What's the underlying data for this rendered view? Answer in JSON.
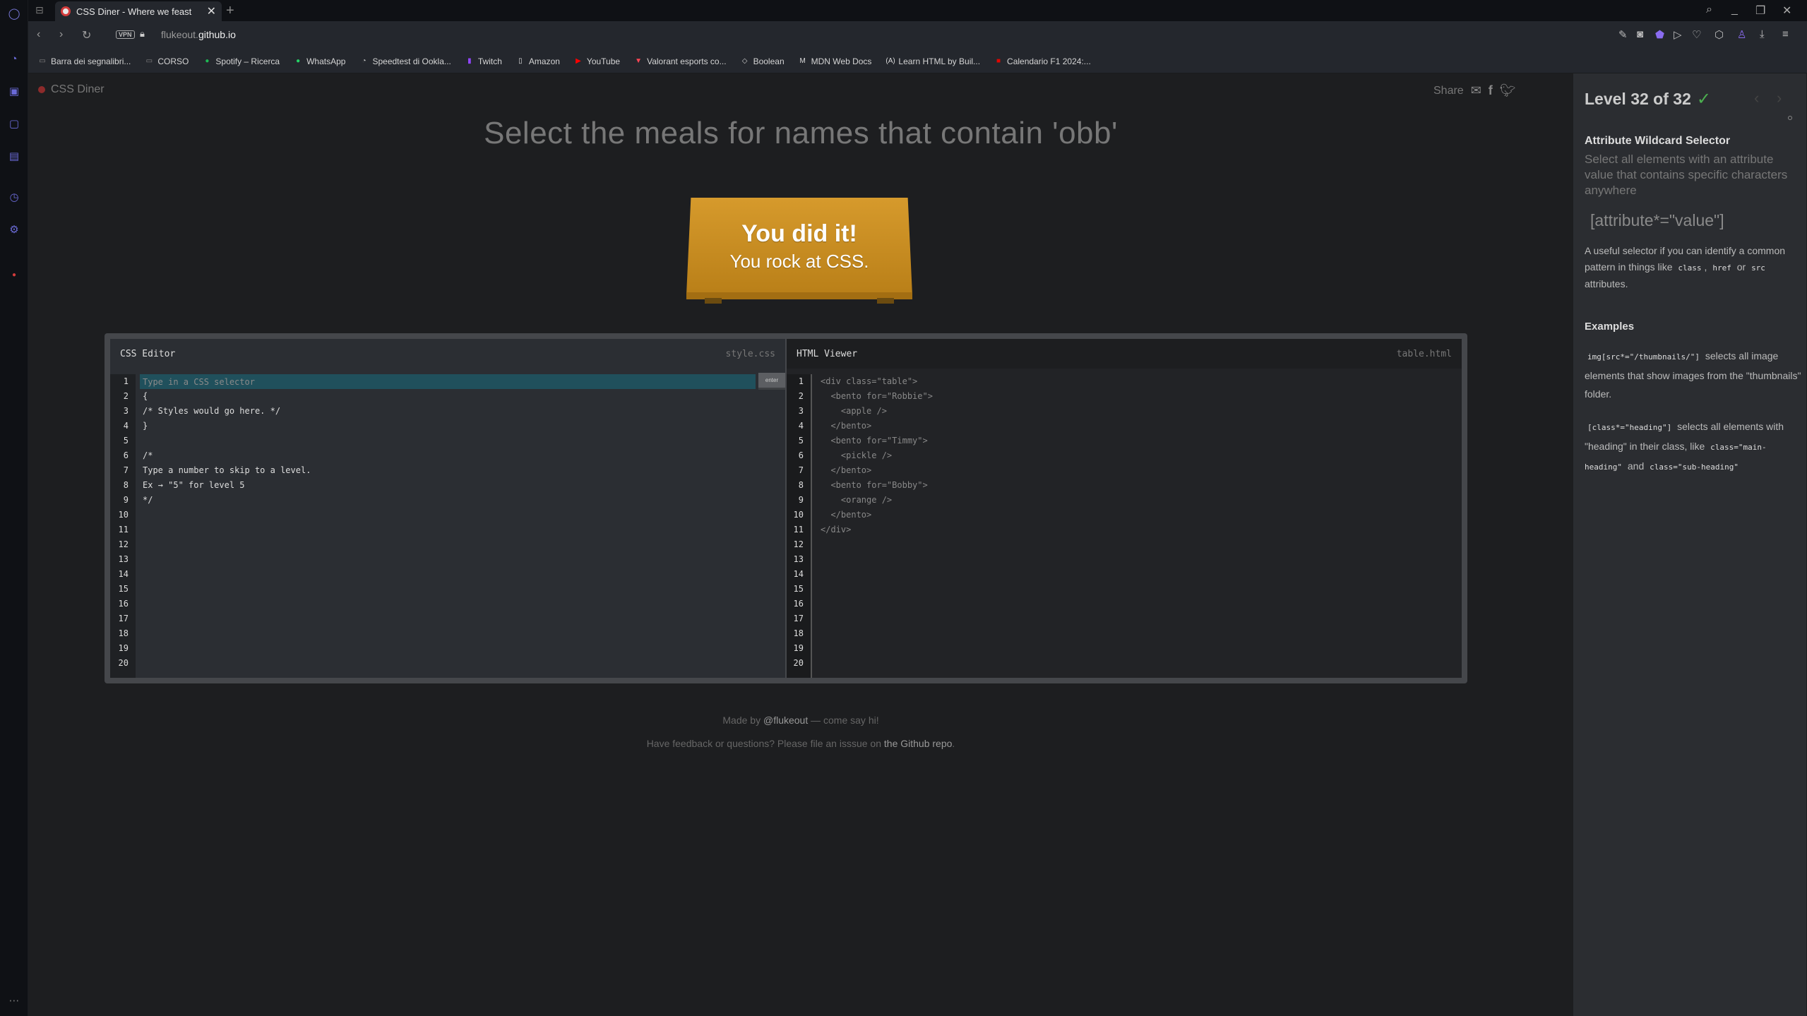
{
  "browser": {
    "tab_title": "CSS Diner - Where we feast",
    "url_host_prefix": "flukeout.",
    "url_host_domain": "github.io",
    "vpn_label": "VPN",
    "bookmarks": [
      {
        "label": "Barra dei segnalibri...",
        "icon": "folder-icon",
        "color": "#888888"
      },
      {
        "label": "CORSO",
        "icon": "folder-icon",
        "color": "#888888"
      },
      {
        "label": "Spotify – Ricerca",
        "icon": "spotify-icon",
        "color": "#1db954"
      },
      {
        "label": "WhatsApp",
        "icon": "whatsapp-icon",
        "color": "#25d366"
      },
      {
        "label": "Speedtest di Ookla...",
        "icon": "speedtest-icon",
        "color": "#cccccc"
      },
      {
        "label": "Twitch",
        "icon": "twitch-icon",
        "color": "#9146ff"
      },
      {
        "label": "Amazon",
        "icon": "page-icon",
        "color": "#dddddd"
      },
      {
        "label": "YouTube",
        "icon": "youtube-icon",
        "color": "#ff0000"
      },
      {
        "label": "Valorant esports co...",
        "icon": "valorant-icon",
        "color": "#ff4655"
      },
      {
        "label": "Boolean",
        "icon": "boolean-icon",
        "color": "#cccccc"
      },
      {
        "label": "MDN Web Docs",
        "icon": "mdn-icon",
        "color": "#dddddd"
      },
      {
        "label": "Learn HTML by Buil...",
        "icon": "freecodecamp-icon",
        "color": "#dddddd"
      },
      {
        "label": "Calendario F1 2024:...",
        "icon": "f1-icon",
        "color": "#e10600"
      }
    ]
  },
  "page": {
    "logo": "CSS Diner",
    "share_label": "Share",
    "instruction": "Select the meals for names that contain 'obb'",
    "win_title": "You did it!",
    "win_subtitle": "You rock at CSS.",
    "css_editor": {
      "title": "CSS Editor",
      "file": "style.css",
      "placeholder": "Type in a CSS selector",
      "enter_label": "enter",
      "lines": [
        "",
        "{",
        "/* Styles would go here. */",
        "}",
        "",
        "/*",
        "Type a number to skip to a level.",
        "Ex → \"5\" for level 5",
        "*/"
      ]
    },
    "html_viewer": {
      "title": "HTML Viewer",
      "file": "table.html",
      "lines": [
        "<div class=\"table\">",
        "  <bento for=\"Robbie\">",
        "    <apple />",
        "  </bento>",
        "  <bento for=\"Timmy\">",
        "    <pickle />",
        "  </bento>",
        "  <bento for=\"Bobby\">",
        "    <orange />",
        "  </bento>",
        "</div>"
      ]
    },
    "line_numbers": [
      "1",
      "2",
      "3",
      "4",
      "5",
      "6",
      "7",
      "8",
      "9",
      "10",
      "11",
      "12",
      "13",
      "14",
      "15",
      "16",
      "17",
      "18",
      "19",
      "20"
    ],
    "footer": {
      "made_by_prefix": "Made by ",
      "made_by_link": "@flukeout",
      "made_by_suffix": " — come say hi!",
      "feedback_prefix": "Have feedback or questions? Please file an isssue on ",
      "feedback_link": "the Github repo",
      "feedback_suffix": "."
    }
  },
  "sidebar": {
    "level": "Level 32 of 32",
    "check": "✓",
    "selector_name": "Attribute Wildcard Selector",
    "title": "Select all elements with an attribute value that contains specific characters anywhere",
    "syntax": "[attribute*=\"value\"]",
    "hint_prefix": "A useful selector if you can identify a common pattern in things like",
    "hint_code1": "class",
    "hint_sep1": ",",
    "hint_code2": "href",
    "hint_sep2": "or",
    "hint_code3": "src",
    "hint_suffix": "attributes.",
    "examples_heading": "Examples",
    "example1_code": "img[src*=\"/thumbnails/\"]",
    "example1_text": "selects all image elements that show images from the \"thumbnails\" folder.",
    "example2_code": "[class*=\"heading\"]",
    "example2_text1": "selects all elements with \"heading\" in their class, like",
    "example2_code2": "class=\"main-heading\"",
    "example2_and": "and",
    "example2_code3": "class=\"sub-heading\""
  },
  "colors": {
    "accent_table": "#c98c22",
    "check_green": "#4caf50",
    "input_highlight": "#20505c"
  }
}
